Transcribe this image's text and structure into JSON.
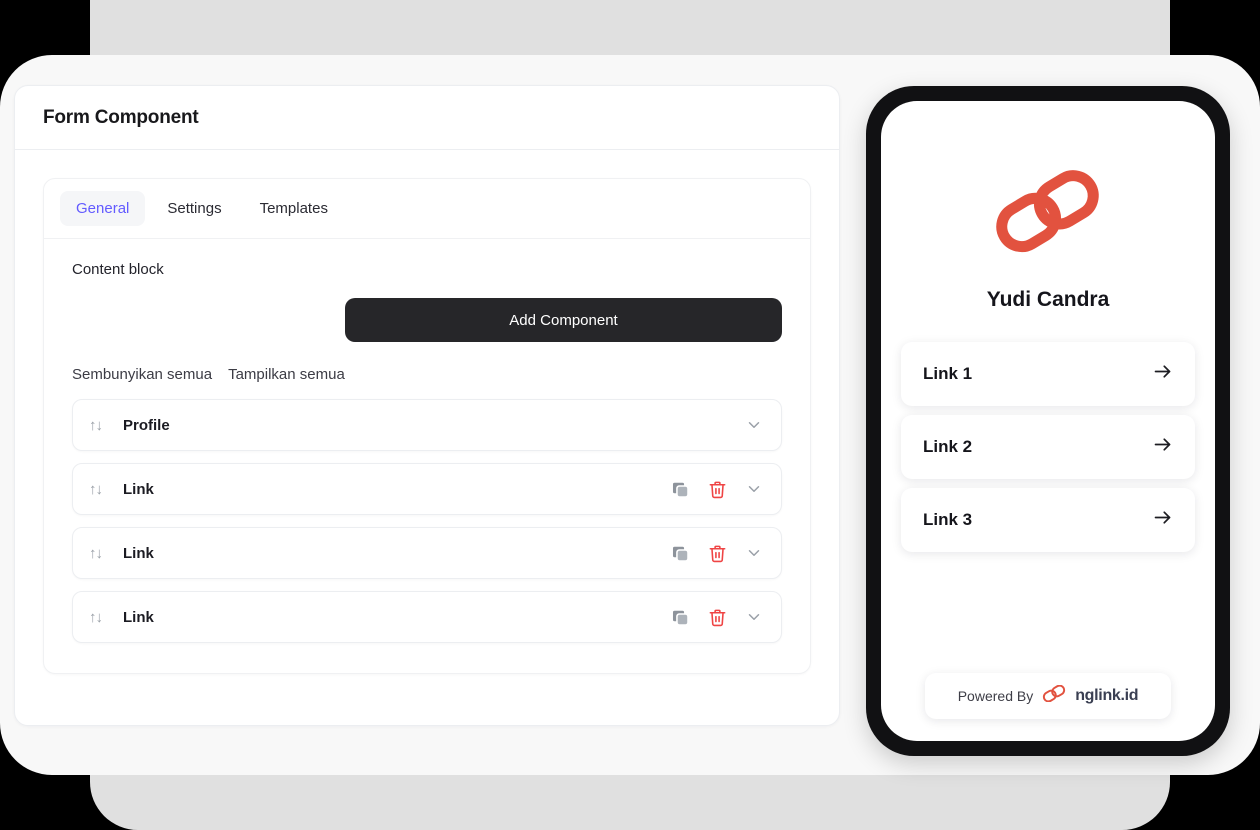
{
  "colors": {
    "accent_indigo": "#635bff",
    "brand_red": "#e2523f",
    "button_dark": "#262629",
    "danger_red": "#ef4444",
    "icon_gray": "#9aa0a8",
    "page_black": "#000000",
    "panel_gray": "#e0e0e0",
    "panel_light": "#f8f8f8"
  },
  "form_card": {
    "title": "Form Component",
    "tabs": [
      {
        "label": "General",
        "active": true
      },
      {
        "label": "Settings",
        "active": false
      },
      {
        "label": "Templates",
        "active": false
      }
    ],
    "section_label": "Content block",
    "add_component_label": "Add Component",
    "toggles": [
      {
        "label": "Sembunyikan semua"
      },
      {
        "label": "Tampilkan semua"
      }
    ],
    "rows": [
      {
        "label": "Profile",
        "drag_glyph": "↑↓",
        "has_copy": false,
        "has_delete": false,
        "has_chevron": true
      },
      {
        "label": "Link",
        "drag_glyph": "↑↓",
        "has_copy": true,
        "has_delete": true,
        "has_chevron": true
      },
      {
        "label": "Link",
        "drag_glyph": "↑↓",
        "has_copy": true,
        "has_delete": true,
        "has_chevron": true
      },
      {
        "label": "Link",
        "drag_glyph": "↑↓",
        "has_copy": true,
        "has_delete": true,
        "has_chevron": true
      }
    ]
  },
  "phone_preview": {
    "logo_icon": "chain-link-logo",
    "profile_name": "Yudi Candra",
    "links": [
      {
        "title": "Link 1",
        "arrow": "arrow-right-icon"
      },
      {
        "title": "Link 2",
        "arrow": "arrow-right-icon"
      },
      {
        "title": "Link 3",
        "arrow": "arrow-right-icon"
      }
    ],
    "footer": {
      "powered_by_text": "Powered By",
      "brand_name": "nglink.id"
    }
  }
}
